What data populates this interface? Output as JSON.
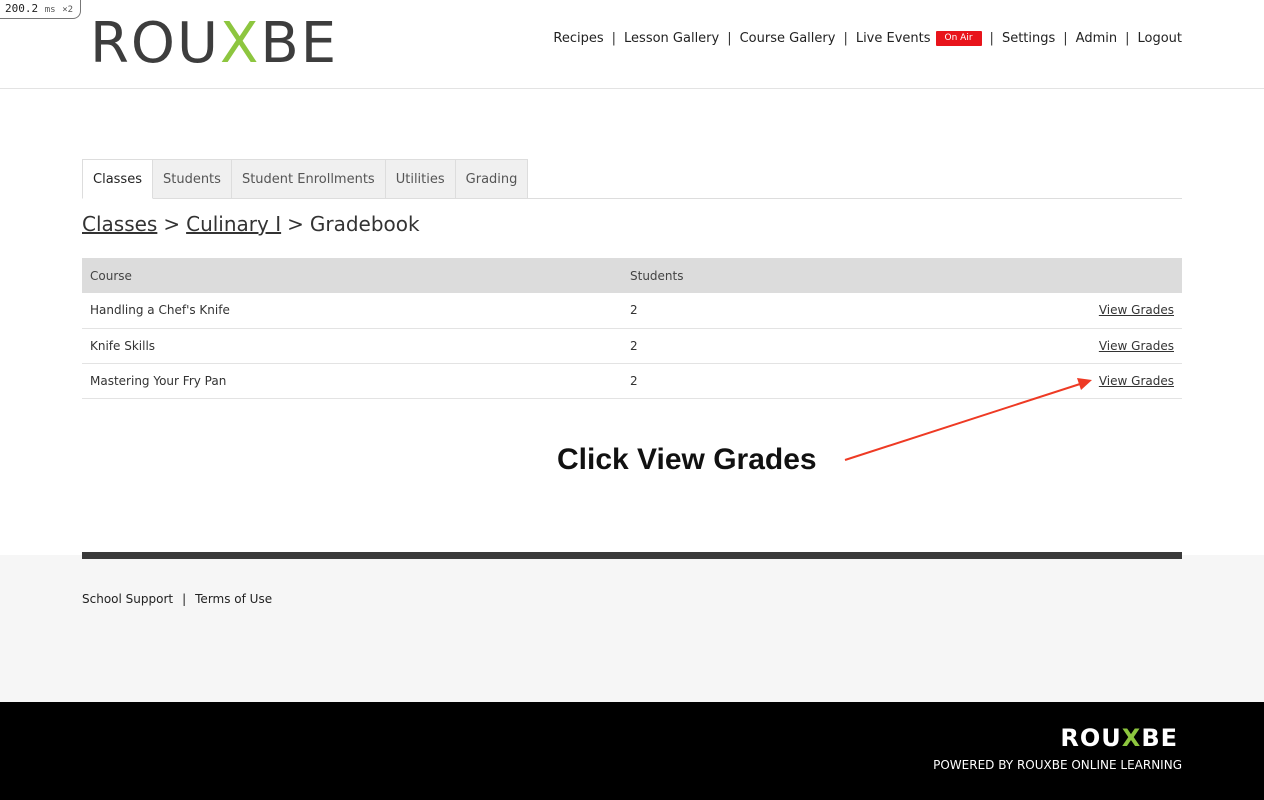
{
  "perf": {
    "value": "200.2",
    "unit": "ms",
    "mult": "×2"
  },
  "logo": {
    "part1": "ROU",
    "x": "X",
    "part2": "BE"
  },
  "nav": {
    "recipes": "Recipes",
    "lesson_gallery": "Lesson Gallery",
    "course_gallery": "Course Gallery",
    "live_events": "Live Events",
    "on_air": "On Air",
    "settings": "Settings",
    "admin": "Admin",
    "logout": "Logout",
    "separator": "|"
  },
  "tabs": [
    "Classes",
    "Students",
    "Student Enrollments",
    "Utilities",
    "Grading"
  ],
  "breadcrumb": {
    "level1": "Classes",
    "level2": "Culinary I",
    "current": "Gradebook",
    "separator": ">"
  },
  "table": {
    "headers": {
      "course": "Course",
      "students": "Students"
    },
    "rows": [
      {
        "course": "Handling a Chef's Knife",
        "students": "2",
        "action": "View Grades"
      },
      {
        "course": "Knife Skills",
        "students": "2",
        "action": "View Grades"
      },
      {
        "course": "Mastering Your Fry Pan",
        "students": "2",
        "action": "View Grades"
      }
    ]
  },
  "annotation": {
    "text": "Click View Grades",
    "color": "#ee3a24"
  },
  "footer": {
    "support": "School Support",
    "terms": "Terms of Use",
    "separator": "|"
  },
  "bottom": {
    "logo_part1": "ROU",
    "logo_x": "X",
    "logo_part2": "BE",
    "powered": "POWERED BY ROUXBE ONLINE LEARNING"
  },
  "colors": {
    "brand_green": "#8dc63f",
    "on_air_red": "#e8141b"
  }
}
